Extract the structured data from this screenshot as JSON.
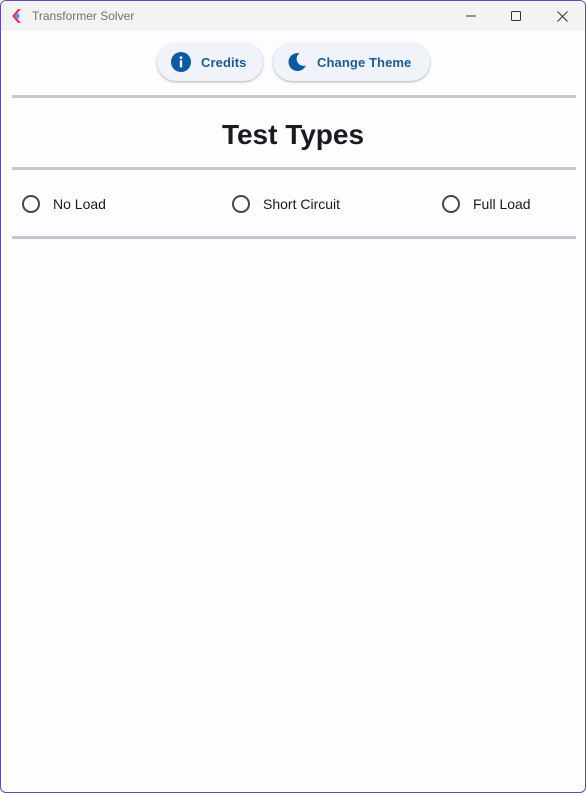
{
  "window": {
    "title": "Transformer Solver"
  },
  "toolbar": {
    "credits_label": "Credits",
    "theme_label": "Change Theme"
  },
  "main": {
    "section_title": "Test Types",
    "test_types": [
      {
        "label": "No Load",
        "selected": false
      },
      {
        "label": "Short Circuit",
        "selected": false
      },
      {
        "label": "Full Load",
        "selected": false
      }
    ]
  },
  "colors": {
    "accent": "#1f5a96",
    "icon_blue": "#0b5aa5",
    "divider": "#c5c6cc",
    "background": "#fdfcff"
  },
  "icons": {
    "app": "flutter-logo-icon",
    "credits": "info-icon",
    "theme": "moon-icon"
  }
}
